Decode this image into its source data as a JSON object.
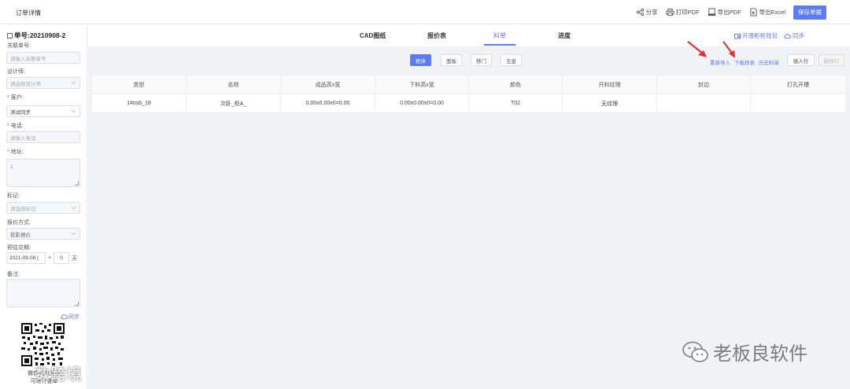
{
  "window": {
    "title": "订单详情"
  },
  "top_actions": {
    "share": "分享",
    "print_pdf": "打印PDF",
    "export_pdf": "导出PDF",
    "export_excel": "导出Excel",
    "save": "保存单据"
  },
  "sidebar": {
    "order_no": "单号:20210908-2",
    "fields": {
      "related_no": {
        "label": "关联单号:",
        "placeholder": "请输入关联单号"
      },
      "designer": {
        "label": "设计师:",
        "placeholder": "请选择设计师"
      },
      "customer": {
        "label": "客户:",
        "value": "测试同步"
      },
      "phone": {
        "label": "电话:",
        "placeholder": "请输入电话"
      },
      "address": {
        "label": "地址:",
        "value": "1"
      },
      "tag": {
        "label": "标记:",
        "placeholder": "请选择标记"
      },
      "quote_method": {
        "label": "报价方式:",
        "value": "投影报价"
      },
      "delivery": {
        "label": "预估交期:",
        "date": "2021-09-08 (",
        "plus": "+",
        "days": "0",
        "unit": "天"
      },
      "remark": {
        "label": "备注:"
      }
    },
    "sync": "同步",
    "qr_caption_1": "微信扫码关注",
    "qr_caption_2": "可进行查单"
  },
  "tabs": [
    {
      "label": "CAD图纸"
    },
    {
      "label": "报价表"
    },
    {
      "label": "料单",
      "active": true
    },
    {
      "label": "进度"
    }
  ],
  "tab_links": {
    "open_cabinet": "开通柜柜钱包",
    "sync": "同步"
  },
  "segments": [
    {
      "label": "柜体",
      "active": true
    },
    {
      "label": "面板"
    },
    {
      "label": "移门"
    },
    {
      "label": "五金"
    }
  ],
  "sub_actions": {
    "reimport": "重新导入",
    "download_sample": "下载样表",
    "history": "历史料单",
    "insert_row": "插入行",
    "delete_row": "删除行"
  },
  "table": {
    "columns": [
      "类型",
      "名称",
      "成品高x宽",
      "下料高x宽",
      "颜色",
      "开料纹理",
      "封边",
      "打孔开槽"
    ],
    "rows": [
      [
        "1#osb_18",
        "次卧_柜A_",
        "0.00x0.00x0=0.00",
        "0.00x0.00x0=0.00",
        "T02",
        "无纹理",
        "",
        ""
      ]
    ]
  },
  "watermarks": {
    "right": "老板良软件",
    "left": "数跨境"
  }
}
